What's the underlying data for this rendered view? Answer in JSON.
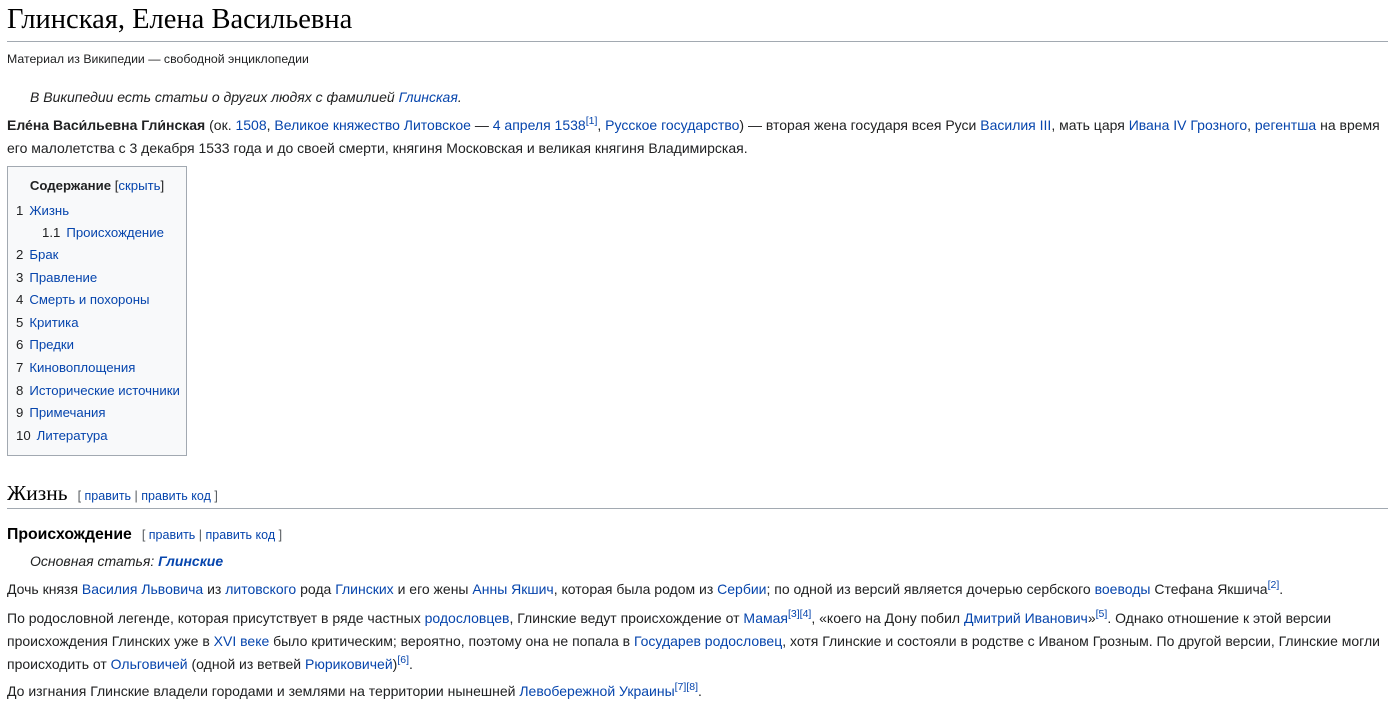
{
  "header": {
    "title": "Глинская, Елена Васильевна",
    "site_sub": "Материал из Википедии — свободной энциклопедии"
  },
  "hatnote": {
    "text": "В Википедии есть статьи о других людях с фамилией ",
    "link": "Глинская",
    "end": "."
  },
  "lead": {
    "name_bold": "Еле́на Васи́льевна Гли́нская",
    "t1": " (ок. ",
    "l1": "1508",
    "t2": ", ",
    "l2": "Великое княжество Литовское",
    "t3": " — ",
    "l3": "4 апреля 1538",
    "ref1": "[1]",
    "t4": ", ",
    "l4": "Русское государство",
    "t5": ") — вторая жена государя всея Руси ",
    "l5": "Василия III",
    "t6": ", мать царя ",
    "l6": "Ивана IV Грозного",
    "t7": ", ",
    "l7": "регентша",
    "t8": " на время его малолетства с 3 декабря 1533 года и до своей смерти, княгиня Московская и великая княгиня Владимирская."
  },
  "toc": {
    "title": "Содержание",
    "bracket_open": " [",
    "toggle": "скрыть",
    "bracket_close": "]",
    "items": [
      {
        "num": "1",
        "label": "Жизнь"
      },
      {
        "num": "1.1",
        "label": "Происхождение"
      },
      {
        "num": "2",
        "label": "Брак"
      },
      {
        "num": "3",
        "label": "Правление"
      },
      {
        "num": "4",
        "label": "Смерть и похороны"
      },
      {
        "num": "5",
        "label": "Критика"
      },
      {
        "num": "6",
        "label": "Предки"
      },
      {
        "num": "7",
        "label": "Киновоплощения"
      },
      {
        "num": "8",
        "label": "Исторические источники"
      },
      {
        "num": "9",
        "label": "Примечания"
      },
      {
        "num": "10",
        "label": "Литература"
      }
    ]
  },
  "edit": {
    "open": "[ ",
    "edit": "править",
    "sep": " | ",
    "edit_code": "править код",
    "close": " ]"
  },
  "section_life": {
    "heading": "Жизнь"
  },
  "section_origin": {
    "heading": "Происхождение",
    "main_article_prefix": "Основная статья: ",
    "main_article_link": "Глинские",
    "p1": {
      "t1": "Дочь князя ",
      "l1": "Василия Львовича",
      "t2": " из ",
      "l2": "литовского",
      "t3": " рода ",
      "l3": "Глинских",
      "t4": " и его жены ",
      "l4": "Анны Якшич",
      "t5": ", которая была родом из ",
      "l5": "Сербии",
      "t6": "; по одной из версий является дочерью сербского ",
      "l6": "воеводы",
      "t7": " Стефана Якшича",
      "ref": "[2]",
      "t8": "."
    },
    "p2": {
      "t1": "По родословной легенде, которая присутствует в ряде частных ",
      "l1": "родословцев",
      "t2": ", Глинские ведут происхождение от ",
      "l2": "Мамая",
      "ref1": "[3][4]",
      "t3": ", «коего на Дону побил ",
      "l3": "Дмитрий Иванович",
      "t4": "»",
      "ref2": "[5]",
      "t5": ". Однако отношение к этой версии происхождения Глинских уже в ",
      "l4": "XVI веке",
      "t6": " было критическим; вероятно, поэтому она не попала в ",
      "l5": "Государев родословец",
      "t7": ", хотя Глинские и состояли в родстве с Иваном Грозным. По другой версии, Глинские могли происходить от ",
      "l6": "Ольговичей",
      "t8": " (одной из ветвей ",
      "l7": "Рюриковичей",
      "t9": ")",
      "ref3": "[6]",
      "t10": "."
    },
    "p3": {
      "t1": "До изгнания Глинские владели городами и землями на территории нынешней ",
      "l1": "Левобережной Украины",
      "ref": "[7][8]",
      "t2": "."
    }
  }
}
